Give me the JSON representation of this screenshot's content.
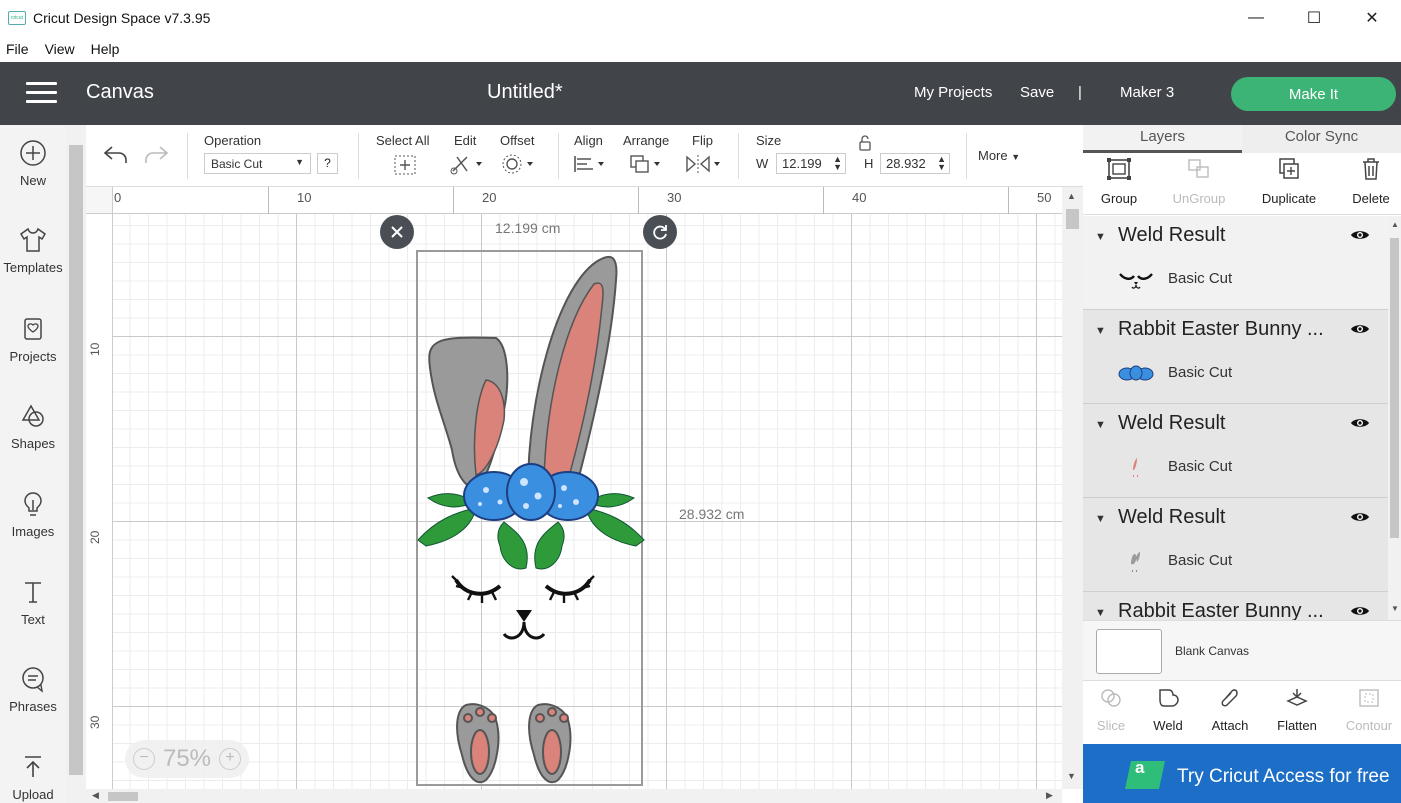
{
  "window": {
    "title": "Cricut Design Space  v7.3.95",
    "logo_text": "cricut",
    "minimize": "—",
    "maximize": "☐",
    "close": "✕"
  },
  "menu": [
    "File",
    "View",
    "Help"
  ],
  "header": {
    "section": "Canvas",
    "doc_title": "Untitled*",
    "my_projects": "My Projects",
    "save": "Save",
    "divider": "|",
    "machine": "Maker 3",
    "make_it": "Make It"
  },
  "sidebar": [
    {
      "label": "New",
      "icon": "plus-circle-icon"
    },
    {
      "label": "Templates",
      "icon": "tshirt-icon"
    },
    {
      "label": "Projects",
      "icon": "projects-icon"
    },
    {
      "label": "Shapes",
      "icon": "shapes-icon"
    },
    {
      "label": "Images",
      "icon": "lightbulb-icon"
    },
    {
      "label": "Text",
      "icon": "text-icon"
    },
    {
      "label": "Phrases",
      "icon": "speech-bubble-icon"
    },
    {
      "label": "Upload",
      "icon": "upload-icon"
    }
  ],
  "toolbar": {
    "operation_label": "Operation",
    "operation_value": "Basic Cut",
    "help": "?",
    "select_all": "Select All",
    "edit": "Edit",
    "offset": "Offset",
    "align": "Align",
    "arrange": "Arrange",
    "flip": "Flip",
    "size_label": "Size",
    "w_label": "W",
    "w_value": "12.199",
    "h_label": "H",
    "h_value": "28.932",
    "more": "More"
  },
  "rulers": {
    "top": [
      "0",
      "10",
      "20",
      "30",
      "40",
      "50"
    ],
    "left": [
      "10",
      "20",
      "30"
    ]
  },
  "canvas": {
    "width_dim": "12.199 cm",
    "height_dim": "28.932 cm",
    "zoom_minus": "−",
    "zoom": "75%",
    "zoom_plus": "+"
  },
  "right_panel": {
    "tabs": [
      "Layers",
      "Color Sync"
    ],
    "layer_tools": [
      {
        "label": "Group",
        "enabled": true
      },
      {
        "label": "UnGroup",
        "enabled": false
      },
      {
        "label": "Duplicate",
        "enabled": true
      },
      {
        "label": "Delete",
        "enabled": true
      }
    ],
    "layers": [
      {
        "name": "Weld Result",
        "operation": "Basic Cut"
      },
      {
        "name": "Rabbit Easter Bunny ...",
        "operation": "Basic Cut"
      },
      {
        "name": "Weld Result",
        "operation": "Basic Cut"
      },
      {
        "name": "Weld Result",
        "operation": "Basic Cut"
      },
      {
        "name": "Rabbit Easter Bunny ...",
        "operation": ""
      }
    ],
    "blank_canvas": "Blank Canvas",
    "bottom_tools": [
      {
        "label": "Slice",
        "enabled": false
      },
      {
        "label": "Weld",
        "enabled": true
      },
      {
        "label": "Attach",
        "enabled": true
      },
      {
        "label": "Flatten",
        "enabled": true
      },
      {
        "label": "Contour",
        "enabled": false
      }
    ],
    "access_logo": "a",
    "access_promo": "Try Cricut Access for free"
  },
  "colors": {
    "header_bg": "#414549",
    "make_it": "#3bb475",
    "access_bg": "#1c6ec7",
    "bunny_gray": "#9a9a9a",
    "bunny_pink": "#d9837a",
    "bow_blue": "#3a8fe0",
    "leaf_green": "#2e9a3a"
  }
}
